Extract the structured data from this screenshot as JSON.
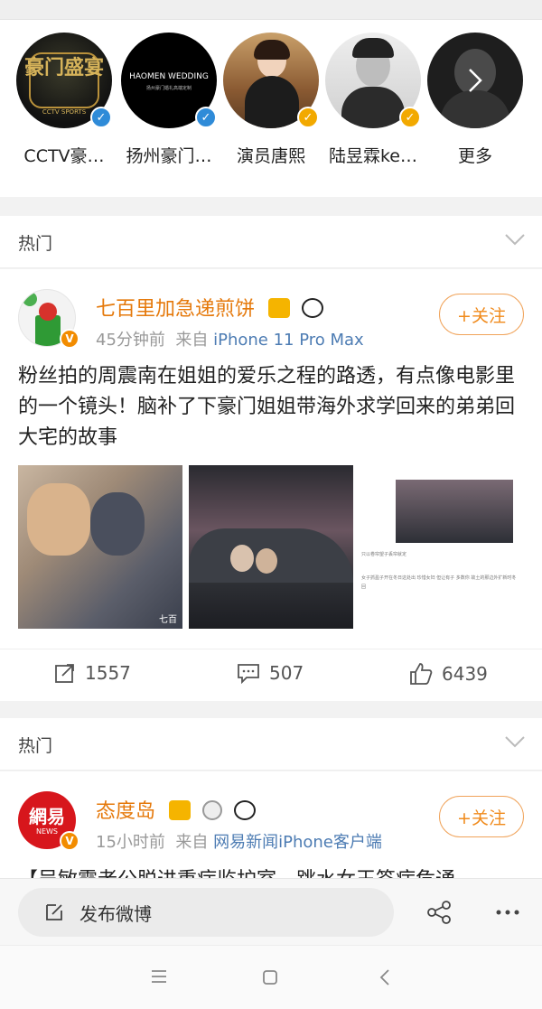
{
  "accounts": [
    {
      "name": "CCTV豪…",
      "logo_text": "豪门盛宴",
      "logo_sub": "CCTV SPORTS",
      "badge": "blue"
    },
    {
      "name": "扬州豪门…",
      "logo_text": "HAOMEN WEDDING",
      "logo_sub": "扬州豪门婚礼高端定制",
      "badge": "blue"
    },
    {
      "name": "演员唐熙",
      "badge": "gold"
    },
    {
      "name": "陆昱霖ke…",
      "badge": "gold"
    },
    {
      "name": "更多"
    }
  ],
  "sections": {
    "hot_label": "热门"
  },
  "post1": {
    "user": "七百里加急递煎饼",
    "time": "45分钟前",
    "from_prefix": "来自",
    "source": "iPhone 11 Pro Max",
    "follow": "+关注",
    "text": "粉丝拍的周震南在姐姐的爱乐之程的路透，有点像电影里的一个镜头！脑补了下豪门姐姐带海外求学回来的弟弟回大宅的故事",
    "image1_mark": "七百",
    "image3_caption1": "只以卷帘望子丢帘就定",
    "image3_caption2": "女子抓盈子开在冬日这处出 珍惜女妇 但让有子 多数你 故土的那边外扩新时冬回",
    "reposts": "1557",
    "comments": "507",
    "likes": "6439"
  },
  "post2": {
    "user": "态度岛",
    "time": "15小时前",
    "from_prefix": "来自",
    "source": "网易新闻iPhone客户端",
    "follow": "+关注",
    "avatar_text": "網易",
    "avatar_sub": "NEWS",
    "text_partial": "【吴敏霞老公脱进重症监护室，跳水女王签病危通"
  },
  "bottom": {
    "compose": "发布微博"
  },
  "colors": {
    "accent": "#e5790b",
    "follow": "#f08a1b",
    "vip_blue": "#2f8bd8",
    "vip_gold": "#f2a900",
    "link": "#4d7cb3"
  }
}
